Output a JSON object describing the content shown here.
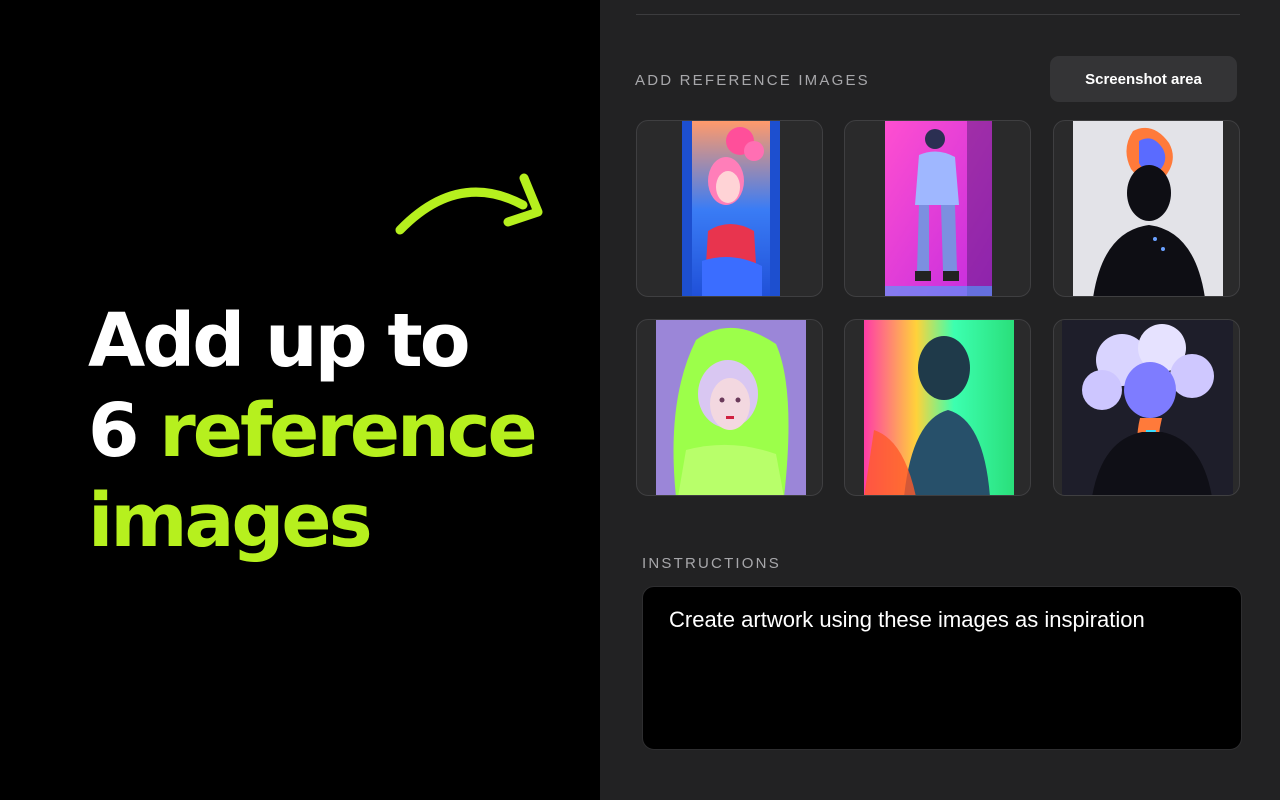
{
  "promo": {
    "headline_line1": "Add up to",
    "headline_line2_num": "6",
    "headline_line2_accent": "reference",
    "headline_line3_accent": "images",
    "accent_color": "#b6f01e"
  },
  "panel": {
    "reference_label": "ADD REFERENCE IMAGES",
    "screenshot_button_label": "Screenshot area",
    "instructions_label": "INSTRUCTIONS",
    "instructions_text": "Create artwork using these images as inspiration"
  },
  "reference_images": [
    {
      "subject": "pink-haired-woman-portrait"
    },
    {
      "subject": "astronaut-streetwear-figure"
    },
    {
      "subject": "silhouette-with-flame-head"
    },
    {
      "subject": "girl-in-neon-hoodie"
    },
    {
      "subject": "neon-profile-portrait"
    },
    {
      "subject": "cloud-haired-figure"
    }
  ]
}
